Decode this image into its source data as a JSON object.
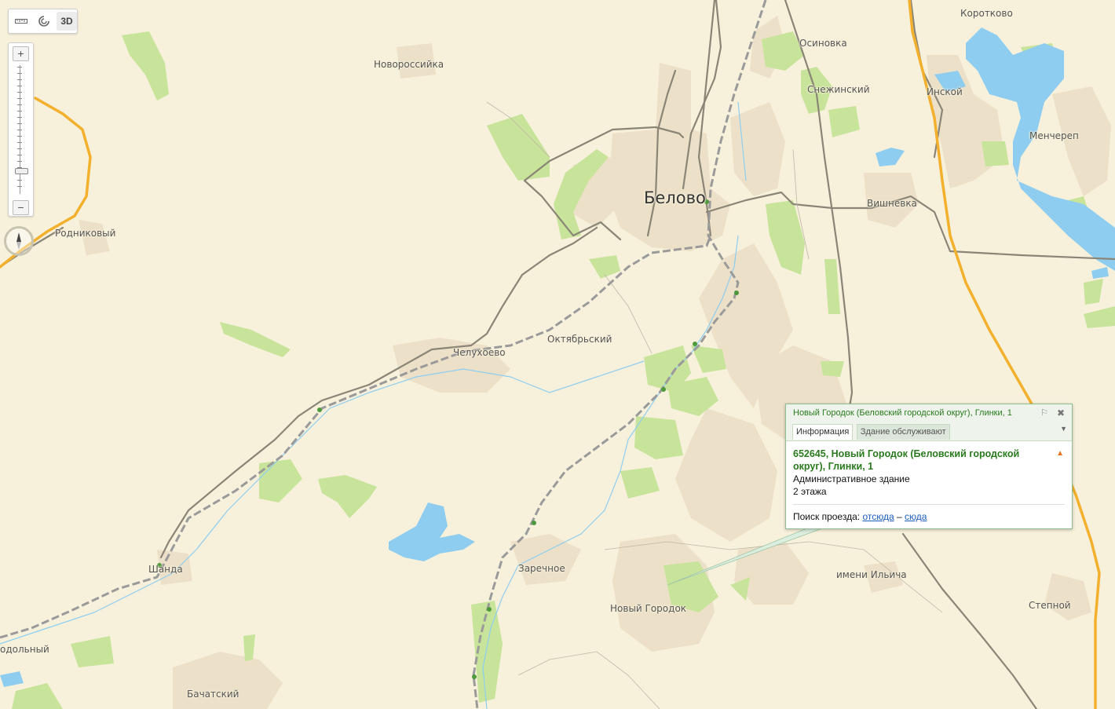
{
  "map": {
    "places": [
      {
        "id": "belovo",
        "name": "Белово",
        "major": true
      },
      {
        "id": "novorossiyka",
        "name": "Новороссийка"
      },
      {
        "id": "osinovka",
        "name": "Осиновка"
      },
      {
        "id": "korotkovo",
        "name": "Коротково"
      },
      {
        "id": "snezhinsky",
        "name": "Снежинский"
      },
      {
        "id": "inskoy",
        "name": "Инской"
      },
      {
        "id": "mencherep",
        "name": "Менчереп"
      },
      {
        "id": "vishnevka",
        "name": "Вишневка"
      },
      {
        "id": "rodnikovy",
        "name": "Родниковый"
      },
      {
        "id": "chelukhoevo",
        "name": "Челухоево"
      },
      {
        "id": "oktyabrsky",
        "name": "Октябрьский"
      },
      {
        "id": "shanda",
        "name": "Шанда"
      },
      {
        "id": "zarechnoe",
        "name": "Заречное"
      },
      {
        "id": "imeni_ilicha",
        "name": "имени Ильича"
      },
      {
        "id": "novy_gorodok",
        "name": "Новый Городок"
      },
      {
        "id": "stepnoy",
        "name": "Степной"
      },
      {
        "id": "podolny",
        "name": "одольный"
      },
      {
        "id": "bachatsky",
        "name": "Бачатский"
      }
    ],
    "colors": {
      "background": "#f7f1dc",
      "urban": "#ece0c8",
      "green": "#c8e39a",
      "water": "#8ecdf0",
      "highway": "#f2b02c",
      "road": "#8a8576",
      "railway": "#9a9a9a"
    }
  },
  "toolbar": {
    "ruler_icon": "ruler-icon",
    "traffic_icon": "traffic-icon",
    "mode_3d_label": "3D"
  },
  "zoom": {
    "plus_label": "+",
    "minus_label": "−",
    "level_fraction": 0.82
  },
  "balloon": {
    "title": "Новый Городок (Беловский городской округ), Глинки, 1",
    "tabs": [
      {
        "label": "Информация",
        "active": true
      },
      {
        "label": "Здание обслуживают",
        "active": false
      }
    ],
    "address": "652645, Новый Городок (Беловский городской округ), Глинки, 1",
    "building_type": "Административное здание",
    "floors": "2 этажа",
    "route_prefix": "Поиск проезда:",
    "route_from": "отсюда",
    "route_dash": "–",
    "route_to": "сюда"
  }
}
